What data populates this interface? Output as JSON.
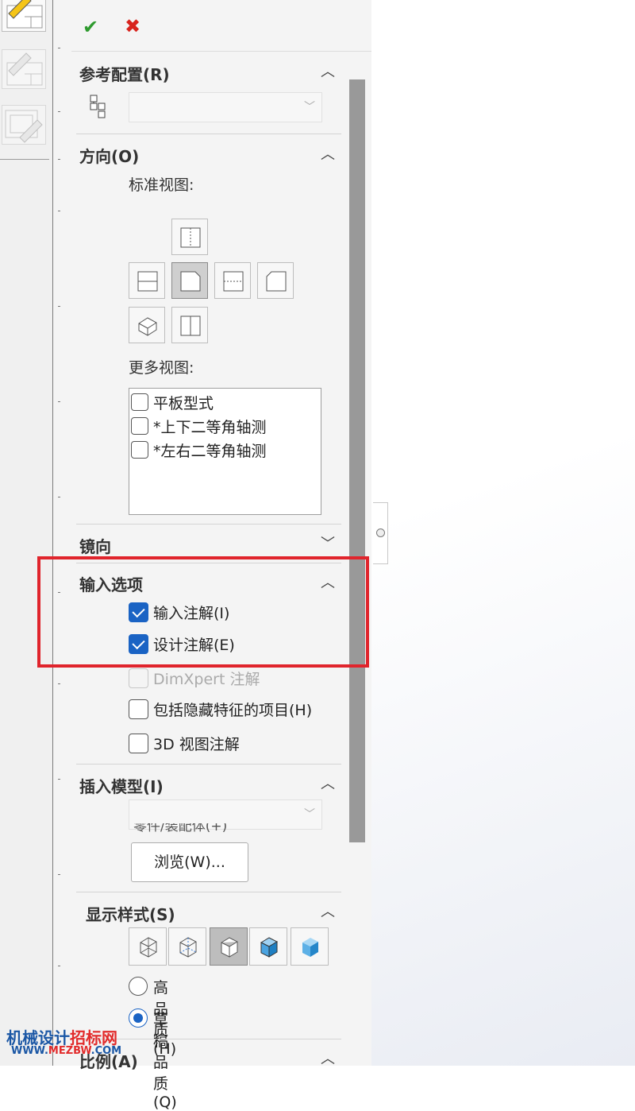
{
  "toolbar": {
    "ok_icon": "checkmark-icon",
    "ok_glyph": "✔",
    "cancel_icon": "close-icon",
    "cancel_glyph": "✖"
  },
  "sections": {
    "reference_config": {
      "title": "参考配置(R)",
      "dropdown_value": ""
    },
    "orientation": {
      "title": "方向(O)",
      "standard_views_label": "标准视图:",
      "more_views_label": "更多视图:",
      "more_views": [
        "平板型式",
        "*上下二等角轴测",
        "*左右二等角轴测"
      ]
    },
    "mirror": {
      "title": "镜向"
    },
    "import_options": {
      "title": "输入选项",
      "options": [
        {
          "label": "输入注解(I)",
          "checked": true,
          "enabled": true
        },
        {
          "label": "设计注解(E)",
          "checked": true,
          "enabled": true
        },
        {
          "label": "DimXpert 注解",
          "checked": false,
          "enabled": false
        },
        {
          "label": "包括隐藏特征的项目(H)",
          "checked": false,
          "enabled": true
        },
        {
          "label": "3D 视图注解",
          "checked": false,
          "enabled": true
        }
      ]
    },
    "insert_model": {
      "title": "插入模型(I)",
      "dropdown_value": "",
      "browse_label": "浏览(W)...",
      "partial_text": "零件/装配体(+)"
    },
    "display_style": {
      "title": "显示样式(S)",
      "buttons": [
        "wireframe-icon",
        "hidden-lines-visible-icon",
        "hidden-lines-removed-icon",
        "shaded-with-edges-icon",
        "shaded-icon"
      ],
      "quality_options": [
        {
          "label": "高品质(H)",
          "selected": false
        },
        {
          "label": "草稿品质(Q)",
          "selected": true
        }
      ]
    },
    "scale": {
      "title": "比例(A)"
    }
  },
  "watermark": {
    "line1_blue": "机械设计",
    "line1_red": "招标网",
    "line2_blue": "WWW.",
    "line2_red": "MEZBW",
    "line2_tail": ".COM"
  },
  "colors": {
    "accent": "#1a63c4",
    "ok": "#2e9a2e",
    "cancel": "#d8231d",
    "highlight": "#e0242c"
  }
}
